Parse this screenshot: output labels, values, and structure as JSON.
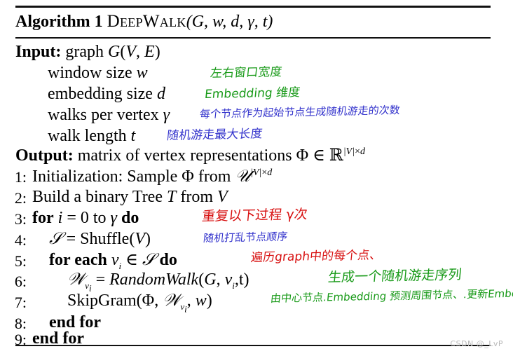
{
  "document": {
    "type": "algorithm-pseudocode-block",
    "watermark": "CSDN @_LvP"
  },
  "colors": {
    "text": "#000000",
    "rule": "#111111",
    "annotation_green": "#189a18",
    "annotation_blue": "#3333cc",
    "annotation_red": "#d81111",
    "watermark": "#b9b9b9"
  },
  "header": {
    "label": "Algorithm 1",
    "name": "DeepWalk",
    "signature": "(G, w, d, γ, t)"
  },
  "io": {
    "input_label": "Input:",
    "input_value": "graph G(V, E)",
    "params": [
      {
        "text": "window size w",
        "annotation": "左右窗口宽度",
        "annotation_color": "green"
      },
      {
        "text": "embedding size d",
        "annotation": "Embedding 维度",
        "annotation_color": "green"
      },
      {
        "text": "walks per vertex γ",
        "annotation": "每个节点作为起始节点生成随机游走的次数",
        "annotation_color": "blue"
      },
      {
        "text": "walk length t",
        "annotation": "随机游走最大长度",
        "annotation_color": "blue"
      }
    ],
    "output_label": "Output:",
    "output_value": "matrix of vertex representations Φ ∈ ℝ^{|V|×d}"
  },
  "steps": [
    {
      "num": "1:",
      "text": "Initialization: Sample Φ from 𝒰^{|V|×d}",
      "annotation": "",
      "annotation_color": ""
    },
    {
      "num": "2:",
      "text": "Build a binary Tree T from V",
      "annotation": "",
      "annotation_color": ""
    },
    {
      "num": "3:",
      "text": "for i = 0 to γ do",
      "annotation": "重复以下过程 γ次",
      "annotation_color": "red"
    },
    {
      "num": "4:",
      "text": "𝒪 = Shuffle(V)",
      "annotation": "随机打乱节点顺序",
      "annotation_color": "blue"
    },
    {
      "num": "5:",
      "text": "for each v_i ∈ 𝒪 do",
      "annotation": "遍历graph中的每个点、",
      "annotation_color": "red"
    },
    {
      "num": "6:",
      "text": "𝒲_{v_i} = RandomWalk(G, v_i, t)",
      "annotation": "生成一个随机游走序列",
      "annotation_color": "green"
    },
    {
      "num": "7:",
      "text": "SkipGram(Φ, 𝒲_{v_i}, w)",
      "annotation": "由中心节点.Embedding 预测周围节点、.更新Embe",
      "annotation_color": "green"
    },
    {
      "num": "8:",
      "text": "end for",
      "annotation": "",
      "annotation_color": ""
    },
    {
      "num": "9:",
      "text": "end for",
      "annotation": "",
      "annotation_color": ""
    }
  ]
}
